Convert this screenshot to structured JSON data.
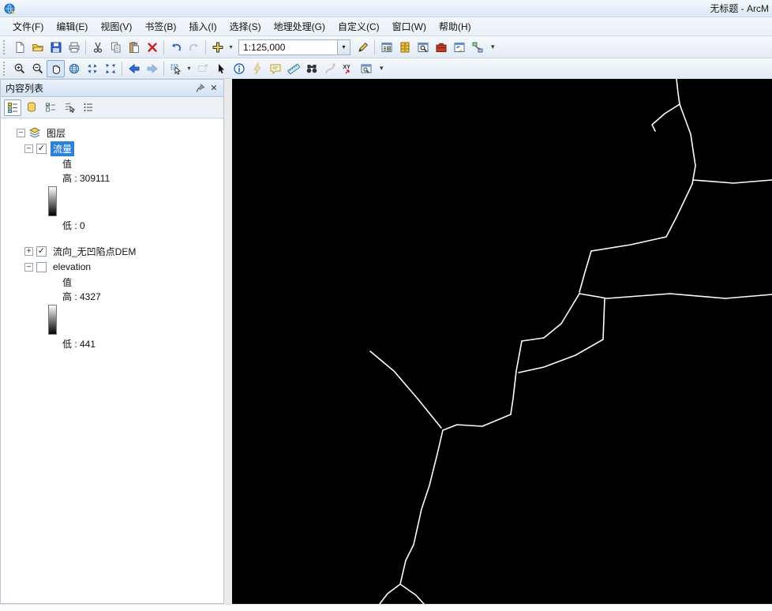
{
  "window": {
    "title": "无标题 - ArcM"
  },
  "menu": {
    "items": [
      {
        "label": "文件(F)"
      },
      {
        "label": "编辑(E)"
      },
      {
        "label": "视图(V)"
      },
      {
        "label": "书签(B)"
      },
      {
        "label": "插入(I)"
      },
      {
        "label": "选择(S)"
      },
      {
        "label": "地理处理(G)"
      },
      {
        "label": "自定义(C)"
      },
      {
        "label": "窗口(W)"
      },
      {
        "label": "帮助(H)"
      }
    ]
  },
  "standard_toolbar": {
    "scale_value": "1:125,000"
  },
  "toc": {
    "title": "内容列表",
    "root_label": "图层",
    "layers": [
      {
        "name": "流量",
        "checked": true,
        "selected": true,
        "legend_value": "值",
        "legend_high": "高 : 309111",
        "legend_low": "低 : 0"
      },
      {
        "name": "流向_无凹陷点DEM",
        "checked": true
      },
      {
        "name": "elevation",
        "checked": false,
        "legend_value": "值",
        "legend_high": "高 : 4327",
        "legend_low": "低 : 441"
      }
    ]
  },
  "icons": {
    "minus": "−",
    "plus": "+",
    "check": "✓",
    "close": "✕",
    "dropdown": "▾",
    "xy_label": "XY",
    "app_icon": "arcmap-globe",
    "toolbar_icons": [
      "new-document",
      "open-folder",
      "save",
      "print",
      "cut",
      "copy",
      "paste",
      "delete",
      "undo",
      "redo",
      "add-data",
      "editor-pencil",
      "toc-window",
      "catalog",
      "search",
      "toolbox",
      "python-window",
      "modelbuilder"
    ],
    "tools_icons": [
      "zoom-in",
      "zoom-out",
      "pan",
      "full-extent",
      "fixed-zoom-in",
      "fixed-zoom-out",
      "back",
      "forward",
      "select-features",
      "clear-selection",
      "select-elements",
      "identify",
      "hyperlink",
      "html-popup",
      "measure",
      "find",
      "find-route",
      "go-to-xy",
      "viewer-window"
    ]
  },
  "colors": {
    "selection": "#2e81d8",
    "map_background": "#000000",
    "stream_color": "#ffffff",
    "ramp_top": "#ffffff",
    "ramp_bottom": "#000000"
  },
  "map": {
    "background": "#000000",
    "stream_color": "#ffffff",
    "streams": [
      "563,0 565,18 567,32",
      "567,32 548,44 532,58 536,66",
      "567,32 581,70 587,110 583,133",
      "584,128 635,132 684,128",
      "583,133 563,175 550,200 505,210 455,218",
      "455,218 447,245 440,270",
      "440,272 475,278 555,272 625,278 684,273",
      "440,272 417,310 395,328 367,332",
      "367,332 360,370 356,405 353,425",
      "353,425 317,440 285,438 267,445",
      "267,445 260,475 250,515 240,545 230,590 220,610 213,640 197,652 187,665",
      "175,345 205,370 235,405 265,442",
      "470,330 435,350 395,365 363,372",
      "472,278 470,330",
      "213,640 233,654 243,665"
    ]
  }
}
